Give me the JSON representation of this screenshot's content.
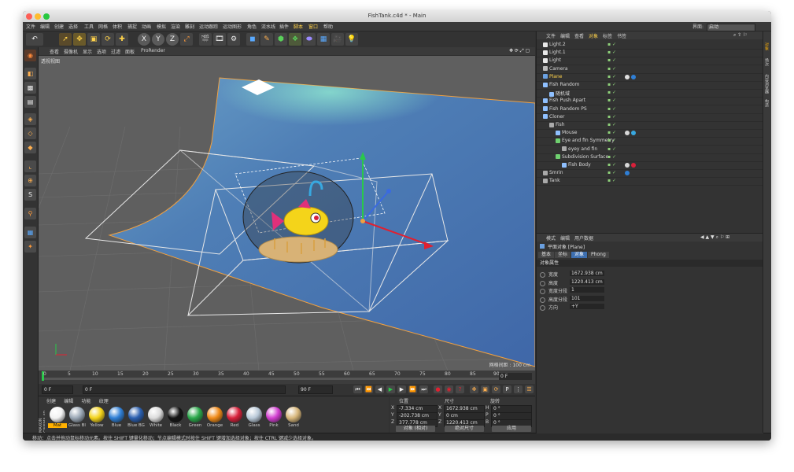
{
  "window": {
    "title": "FishTank.c4d * - Main"
  },
  "menu": {
    "items": [
      "文件",
      "编辑",
      "创建",
      "选择",
      "工具",
      "网格",
      "体积",
      "捕捉",
      "动画",
      "模拟",
      "渲染",
      "雕刻",
      "运动跟踪",
      "运动图形",
      "角色",
      "流水线",
      "插件",
      "脚本",
      "窗口",
      "帮助"
    ],
    "layout_label": "界面:",
    "layout_value": "启动"
  },
  "toolbar": {
    "x_label": "X",
    "y_label": "Y",
    "z_label": "Z"
  },
  "viewport": {
    "menu": [
      "查看",
      "摄像机",
      "显示",
      "选项",
      "过滤",
      "面板",
      "ProRender"
    ],
    "camera_label": "透视视图",
    "grid_label": "网格间距 : 100 cm"
  },
  "timeline": {
    "ticks": [
      "0",
      "5",
      "10",
      "15",
      "20",
      "25",
      "30",
      "35",
      "40",
      "45",
      "50",
      "55",
      "60",
      "65",
      "70",
      "75",
      "80",
      "85",
      "90"
    ],
    "current_frame": "0 F"
  },
  "transport": {
    "start": "0 F",
    "field": "0 F",
    "end_field": "90 F",
    "end": "90 F"
  },
  "materials": {
    "tabs": [
      "创建",
      "编辑",
      "功能",
      "纹理"
    ],
    "items": [
      {
        "name": "Mat",
        "color": "#f2f2f2"
      },
      {
        "name": "Glass Bl",
        "color": "#9aa7b5"
      },
      {
        "name": "Yellow",
        "color": "#f3d31a"
      },
      {
        "name": "Blue",
        "color": "#2f7fd6"
      },
      {
        "name": "Blue BG",
        "color": "#2a5fb0"
      },
      {
        "name": "White",
        "color": "#dcdcdc"
      },
      {
        "name": "Black",
        "color": "#151515"
      },
      {
        "name": "Green",
        "color": "#2aa84a"
      },
      {
        "name": "Orange",
        "color": "#f08a18"
      },
      {
        "name": "Red",
        "color": "#d8203a"
      },
      {
        "name": "Glass",
        "color": "#b9c9d8"
      },
      {
        "name": "Pink",
        "color": "#d23fd0"
      },
      {
        "name": "Sand",
        "color": "#d7b67a"
      }
    ],
    "brand": "MAXON CINEMA 4D"
  },
  "coords": {
    "hdr_pos": "位置",
    "hdr_size": "尺寸",
    "hdr_rot": "旋转",
    "rows": [
      {
        "axis": "X",
        "pos": "-7.334 cm",
        "saxis": "X",
        "size": "1672.938 cm",
        "raxis": "H",
        "rot": "0 °"
      },
      {
        "axis": "Y",
        "pos": "-202.738 cm",
        "saxis": "Y",
        "size": "0 cm",
        "raxis": "P",
        "rot": "0 °"
      },
      {
        "axis": "Z",
        "pos": "377.778 cm",
        "saxis": "Z",
        "size": "1220.413 cm",
        "raxis": "B",
        "rot": "0 °"
      }
    ],
    "mode_object": "对象 (相对)",
    "mode_size": "绝对尺寸",
    "apply": "应用"
  },
  "status": "移动：点击并拖动鼠标移动元素。按住 SHIFT 键量化移动；节点编辑模式时按住 SHIFT 键增加选择对象；按住 CTRL 键减少选择对象。",
  "objects": {
    "menu": [
      "文件",
      "编辑",
      "查看",
      "对象",
      "标签",
      "书签"
    ],
    "rows": [
      {
        "name": "Light.2",
        "indent": 0,
        "icon": "#e8e8e8",
        "tags": []
      },
      {
        "name": "Light.1",
        "indent": 0,
        "icon": "#e8e8e8",
        "tags": []
      },
      {
        "name": "Light",
        "indent": 0,
        "icon": "#e8e8e8",
        "tags": []
      },
      {
        "name": "Camera",
        "indent": 0,
        "icon": "#bbbbbb",
        "tags": []
      },
      {
        "name": "Plane",
        "indent": 0,
        "icon": "#6aa0e0",
        "tags": [
          "#e0e0e0",
          "#2f7fd6"
        ],
        "active": true
      },
      {
        "name": "Fish Random",
        "indent": 0,
        "icon": "#8fc0ff",
        "tags": []
      },
      {
        "name": "随机域",
        "indent": 1,
        "icon": "#8fc0ff",
        "tags": []
      },
      {
        "name": "Fish Push Apart",
        "indent": 0,
        "icon": "#8fc0ff",
        "tags": []
      },
      {
        "name": "Fish Random PS",
        "indent": 0,
        "icon": "#8fc0ff",
        "tags": []
      },
      {
        "name": "Cloner",
        "indent": 0,
        "icon": "#8fc0ff",
        "tags": []
      },
      {
        "name": "Fish",
        "indent": 1,
        "icon": "#aaaaaa",
        "tags": []
      },
      {
        "name": "Mouse",
        "indent": 2,
        "icon": "#8fc0ff",
        "tags": [
          "#d8d8d8",
          "#38a8e0"
        ]
      },
      {
        "name": "Eye and fin Symmetry",
        "indent": 2,
        "icon": "#6fd06f",
        "tags": []
      },
      {
        "name": "eyey and fin",
        "indent": 3,
        "icon": "#aaaaaa",
        "tags": []
      },
      {
        "name": "Subdivision Surface",
        "indent": 2,
        "icon": "#6fd06f",
        "tags": []
      },
      {
        "name": "Fish Body",
        "indent": 3,
        "icon": "#8fc0ff",
        "tags": [
          "#d8d8d8",
          "#d8203a"
        ]
      },
      {
        "name": "Smrin",
        "indent": 0,
        "icon": "#aaaaaa",
        "tags": [
          "#2f7fd6"
        ]
      },
      {
        "name": "Tank",
        "indent": 0,
        "icon": "#aaaaaa",
        "tags": []
      }
    ]
  },
  "attributes": {
    "menu": [
      "模式",
      "编辑",
      "用户数据"
    ],
    "title": "平面对象 [Plane]",
    "tabs": [
      "基本",
      "坐标",
      "对象",
      "Phong"
    ],
    "section": "对象属性",
    "props": [
      {
        "label": "宽度",
        "value": "1672.938 cm"
      },
      {
        "label": "高度",
        "value": "1220.413 cm"
      },
      {
        "label": "宽度分段",
        "value": "1"
      },
      {
        "label": "高度分段",
        "value": "101"
      },
      {
        "label": "方向",
        "value": "+Y"
      }
    ]
  },
  "sidestrip": [
    "对象",
    "场次",
    "内容浏览器",
    "构造"
  ]
}
